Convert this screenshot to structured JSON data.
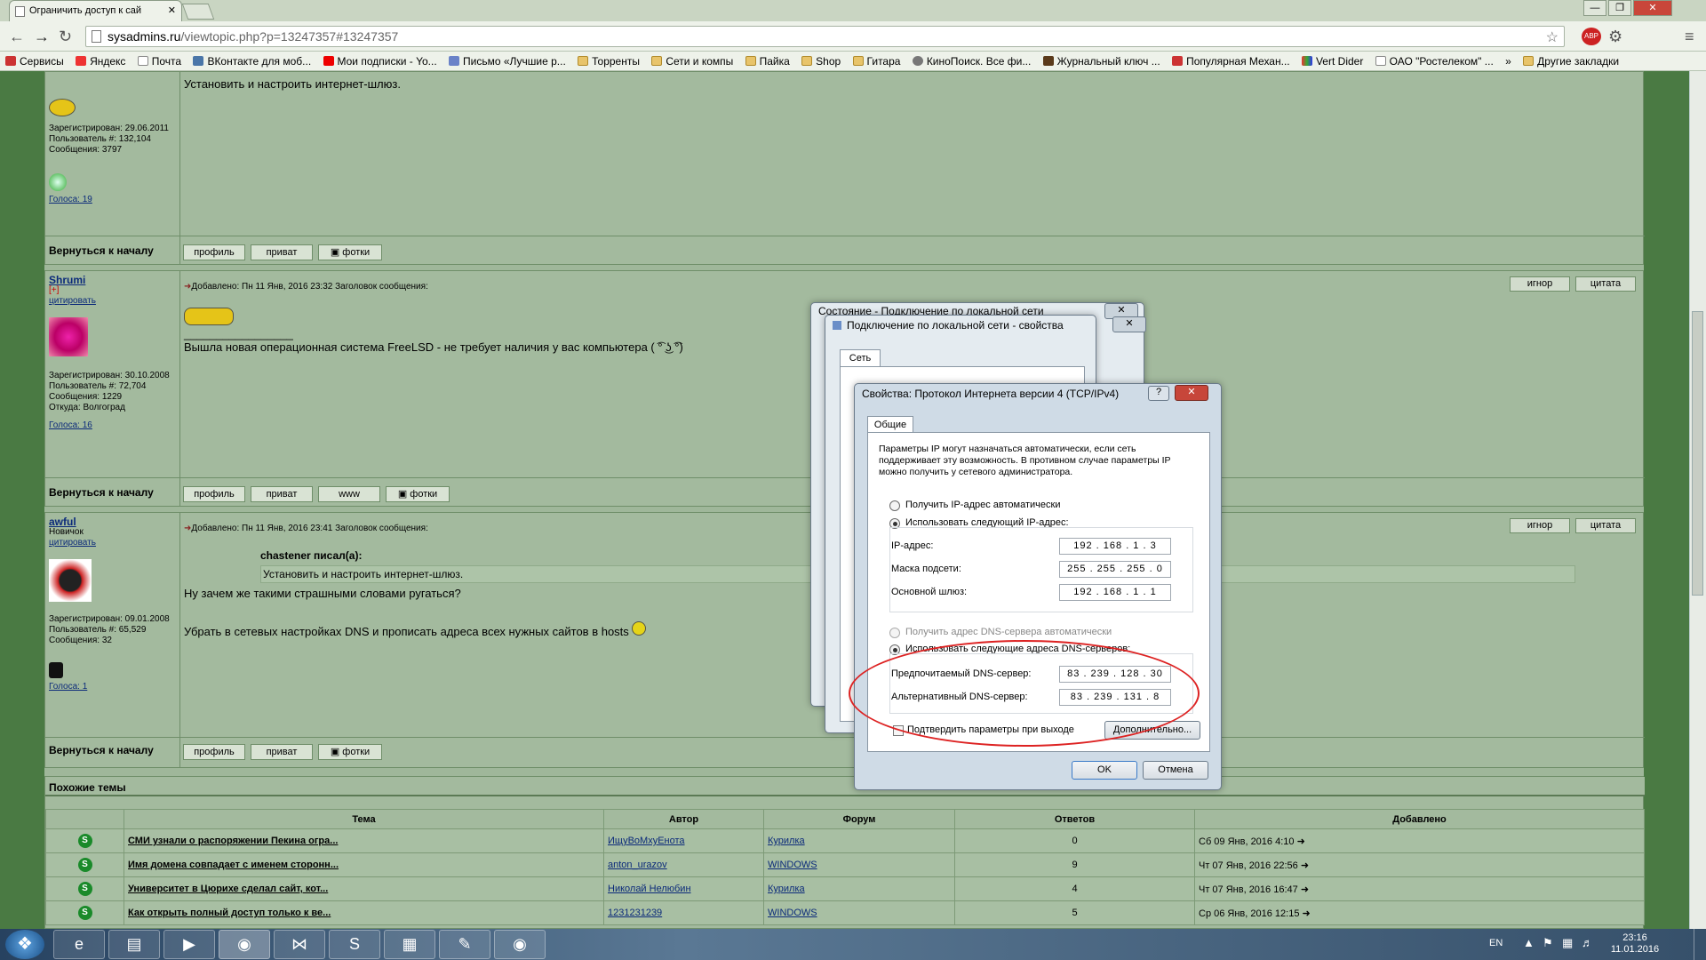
{
  "browser": {
    "tab_title": "Ограничить доступ к сай",
    "url_host": "sysadmins.ru",
    "url_path": "/viewtopic.php?p=13247357#13247357",
    "win_min": "—",
    "win_max": "❐",
    "win_close": "✕",
    "tab_close": "✕",
    "bookmarks": [
      "Сервисы",
      "Яндекс",
      "Почта",
      "ВКонтакте для моб...",
      "Мои подписки - Yo...",
      "Письмо «Лучшие р...",
      "Торренты",
      "Сети и компы",
      "Пайка",
      "Shop",
      "Гитара",
      "КиноПоиск. Все фи...",
      "Журнальный ключ ...",
      "Популярная Механ...",
      "Vert Dider",
      "ОАО \"Ростелеком\" ...",
      "»",
      "Другие закладки"
    ]
  },
  "posts": [
    {
      "user": "",
      "reg": "Зарегистрирован: 29.06.2011",
      "uid": "Пользователь #: 132,104",
      "msgs": "Сообщения: 3797",
      "votes": "Голоса: 19",
      "text": "Установить и настроить интернет-шлюз.",
      "back": "Вернуться к началу",
      "btns": [
        "профиль",
        "приват",
        "фотки"
      ]
    },
    {
      "user": "Shrumi",
      "plus": "[+]",
      "quote": "цитировать",
      "hdr": "Добавлено: Пн 11 Янв, 2016 23:32    Заголовок сообщения:",
      "sep": "_________________",
      "text": "Вышла новая операционная система FreeLSD - не требует наличия у вас компьютера ( ͡° ͜ʖ ͡°)",
      "reg": "Зарегистрирован: 30.10.2008",
      "uid": "Пользователь #: 72,704",
      "msgs": "Сообщения: 1229",
      "from": "Откуда: Волгоград",
      "votes": "Голоса: 16",
      "back": "Вернуться к началу",
      "btns": [
        "профиль",
        "приват",
        "www",
        "фотки"
      ],
      "right": [
        "игнор",
        "цитата"
      ]
    },
    {
      "user": "awful",
      "rank": "Новичок",
      "quote": "цитировать",
      "hdr": "Добавлено: Пн 11 Янв, 2016 23:41    Заголовок сообщения:",
      "qauthor": "chastener писал(а):",
      "qtext": "Установить и настроить интернет-шлюз.",
      "text1": "Ну зачем же такими страшными словами ругаться?",
      "text2": "Убрать в сетевых настройках DNS и прописать адреса всех нужных сайтов в hosts",
      "reg": "Зарегистрирован: 09.01.2008",
      "uid": "Пользователь #: 65,529",
      "msgs": "Сообщения: 32",
      "votes": "Голоса: 1",
      "back": "Вернуться к началу",
      "btns": [
        "профиль",
        "приват",
        "фотки"
      ],
      "right": [
        "игнор",
        "цитата"
      ]
    }
  ],
  "similar": {
    "title": "Похожие темы",
    "cols": [
      "Тема",
      "Автор",
      "Форум",
      "Ответов",
      "Добавлено"
    ],
    "rows": [
      [
        "СМИ узнали о распоряжении Пекина огра...",
        "ИщуВоМхуЕнота",
        "Курилка",
        "0",
        "Сб 09 Янв, 2016 4:10"
      ],
      [
        "Имя домена совпадает с именем сторонн...",
        "anton_urazov",
        "WINDOWS",
        "9",
        "Чт 07 Янв, 2016 22:56"
      ],
      [
        "Университет в Цюрихе сделал сайт, кот...",
        "Николай Нелюбин",
        "Курилка",
        "4",
        "Чт 07 Янв, 2016 16:47"
      ],
      [
        "Как открыть полный доступ только к ве...",
        "1231231239",
        "WINDOWS",
        "5",
        "Ср 06 Янв, 2016 12:15"
      ]
    ]
  },
  "dialogs": {
    "d1_title": "Состояние - Подключение по локальной сети",
    "d2_title": "Подключение по локальной сети - свойства",
    "d2_tab": "Сеть",
    "d3_title": "Свойства: Протокол Интернета версии 4 (TCP/IPv4)",
    "d3_tab": "Общие",
    "help": "?",
    "intro": "Параметры IP могут назначаться автоматически, если сеть поддерживает эту возможность. В противном случае параметры IP можно получить у сетевого администратора.",
    "ip_auto": "Получить IP-адрес автоматически",
    "ip_manual": "Использовать следующий IP-адрес:",
    "ip_label": "IP-адрес:",
    "ip": "192 . 168 . 1 . 3",
    "mask_label": "Маска подсети:",
    "mask": "255 . 255 . 255 . 0",
    "gw_label": "Основной шлюз:",
    "gw": "192 . 168 . 1 . 1",
    "dns_auto": "Получить адрес DNS-сервера автоматически",
    "dns_manual": "Использовать следующие адреса DNS-серверов:",
    "dns1_label": "Предпочитаемый DNS-сервер:",
    "dns1": "83 . 239 . 128 . 30",
    "dns2_label": "Альтернативный DNS-сервер:",
    "dns2": "83 . 239 . 131 . 8",
    "confirm": "Подтвердить параметры при выходе",
    "advanced": "Дополнительно...",
    "ok": "OK",
    "cancel": "Отмена"
  },
  "taskbar": {
    "lang": "EN",
    "time": "23:16",
    "date": "11.01.2016"
  }
}
